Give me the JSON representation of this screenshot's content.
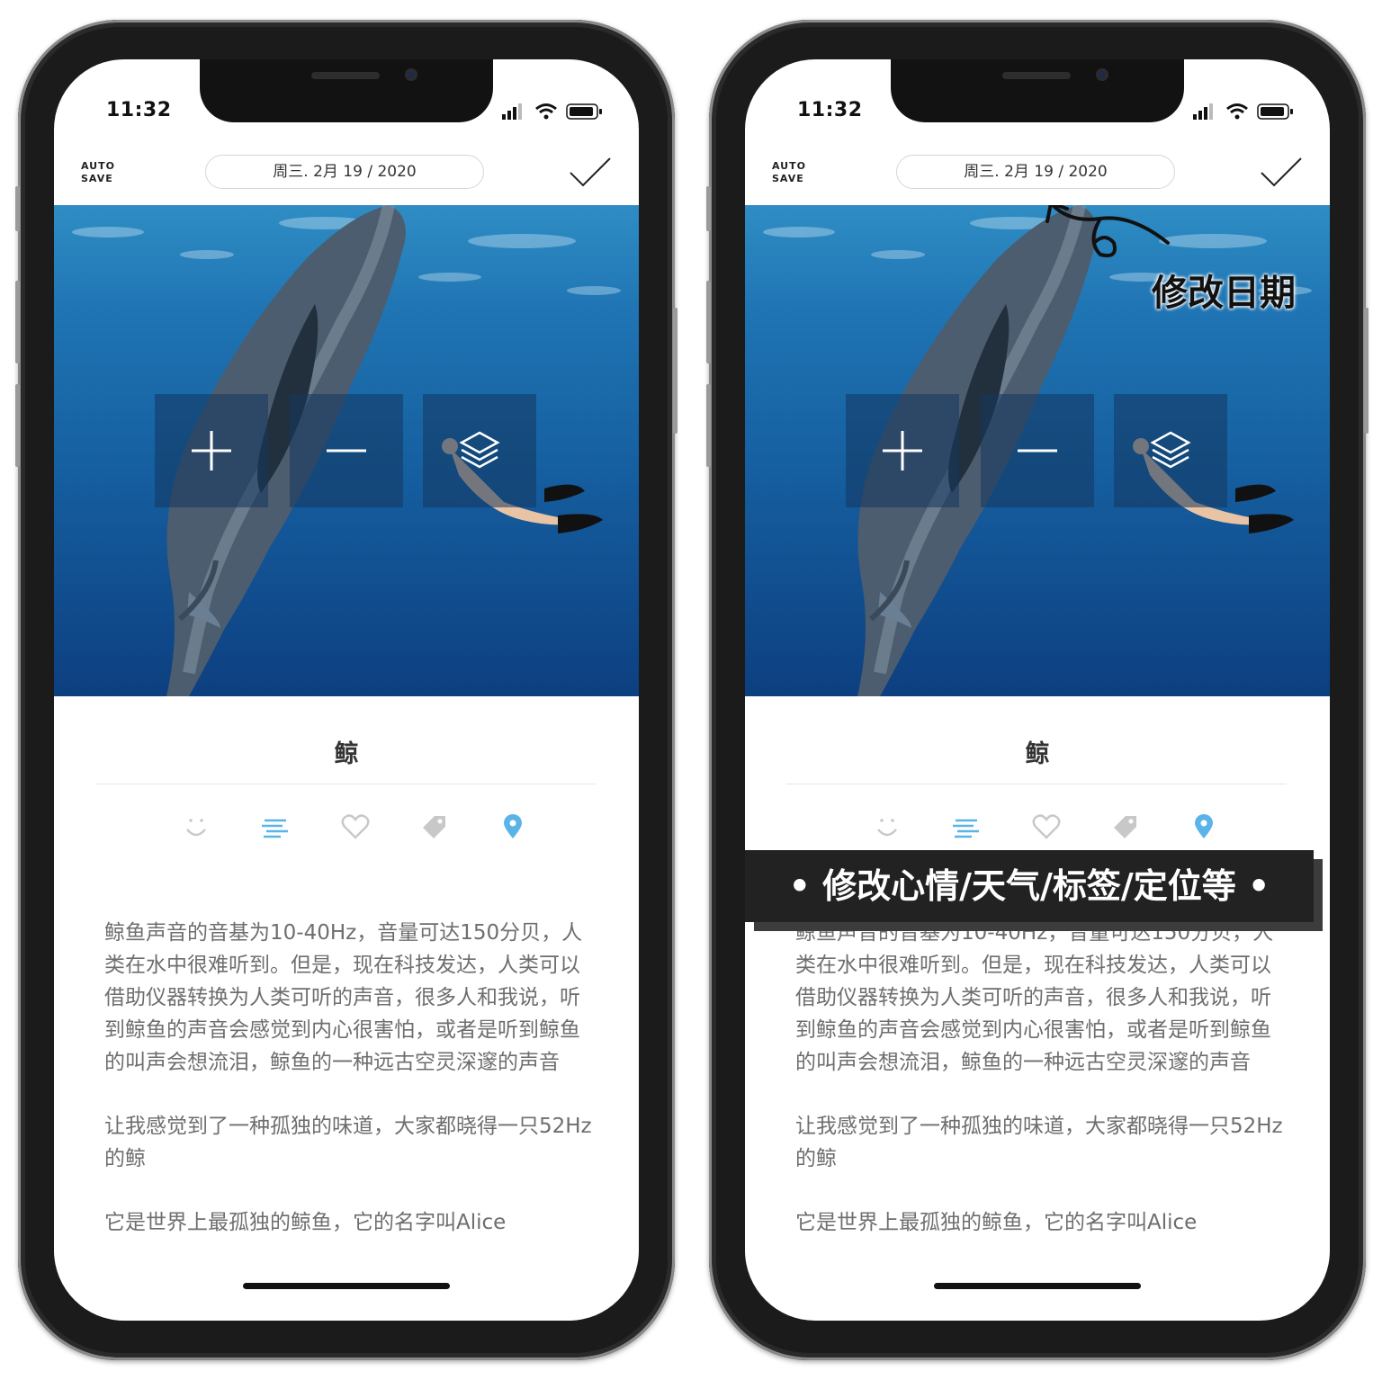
{
  "phones": [
    {
      "status": {
        "time": "11:32"
      },
      "header": {
        "autosave_top": "AUTO",
        "autosave_bottom": "SAVE",
        "date": "周三. 2月 19 / 2020"
      },
      "photo_controls": [
        "plus-icon",
        "minus-icon",
        "layers-icon"
      ],
      "entry": {
        "title": "鲸",
        "paragraphs": [
          "鲸鱼声音的音基为10-40Hz，音量可达150分贝，人类在水中很难听到。但是，现在科技发达，人类可以借助仪器转换为人类可听的声音，很多人和我说，听到鲸鱼的声音会感觉到内心很害怕，或者是听到鲸鱼的叫声会想流泪，鲸鱼的一种远古空灵深邃的声音",
          "让我感觉到了一种孤独的味道，大家都晓得一只52Hz的鲸",
          "它是世界上最孤独的鲸鱼，它的名字叫Alice"
        ]
      },
      "toolbar_icons": [
        "smile-icon",
        "weather-icon",
        "heart-icon",
        "tag-icon",
        "location-pin-icon"
      ]
    },
    {
      "status": {
        "time": "11:32"
      },
      "header": {
        "autosave_top": "AUTO",
        "autosave_bottom": "SAVE",
        "date": "周三. 2月 19 / 2020"
      },
      "photo_controls": [
        "plus-icon",
        "minus-icon",
        "layers-icon"
      ],
      "entry": {
        "title": "鲸",
        "paragraphs": [
          "鲸鱼声音的音基为10-40Hz，音量可达150分贝，人类在水中很难听到。但是，现在科技发达，人类可以借助仪器转换为人类可听的声音，很多人和我说，听到鲸鱼的声音会感觉到内心很害怕，或者是听到鲸鱼的叫声会想流泪，鲸鱼的一种远古空灵深邃的声音",
          "让我感觉到了一种孤独的味道，大家都晓得一只52Hz的鲸",
          "它是世界上最孤独的鲸鱼，它的名字叫Alice"
        ]
      },
      "toolbar_icons": [
        "smile-icon",
        "weather-icon",
        "heart-icon",
        "tag-icon",
        "location-pin-icon"
      ]
    }
  ],
  "annotations": {
    "date_hint": "修改日期",
    "toolbar_hint": "• 修改心情/天气/标签/定位等 •"
  },
  "colors": {
    "accent": "#5ab4e8",
    "icon_gray": "#c8c8c8",
    "text": "#6e6e6e",
    "banner": "#222222"
  }
}
